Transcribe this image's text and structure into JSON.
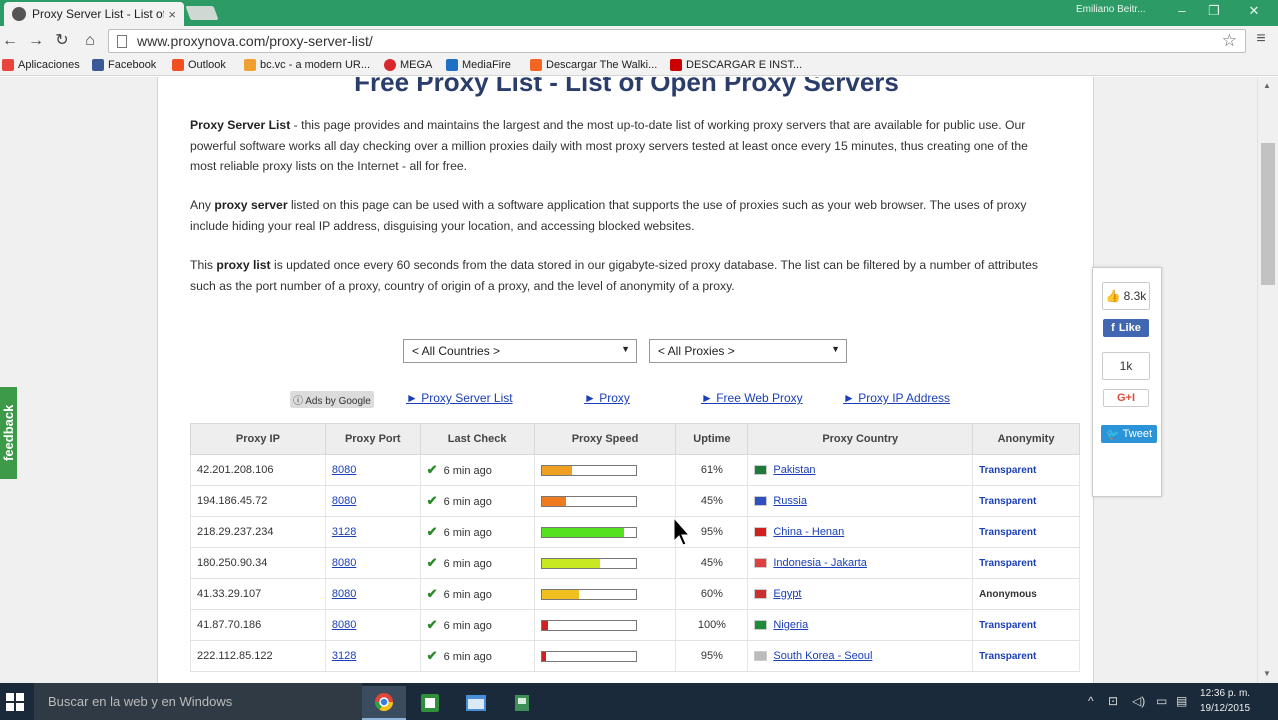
{
  "browser": {
    "tab_title": "Proxy Server List - List of F",
    "tab_close": "×",
    "user_name": "Emiliano Beitr...",
    "url": "www.proxynova.com/proxy-server-list/"
  },
  "bookmarks": [
    {
      "label": "Aplicaciones",
      "color": "#e8453c"
    },
    {
      "label": "Facebook",
      "color": "#3b5998"
    },
    {
      "label": "Outlook",
      "color": "#f25022"
    },
    {
      "label": "bc.vc - a modern UR...",
      "color": "#f0a030"
    },
    {
      "label": "MEGA",
      "color": "#d9272e"
    },
    {
      "label": "MediaFire",
      "color": "#1f6fc5"
    },
    {
      "label": "Descargar The Walki...",
      "color": "#f26522"
    },
    {
      "label": "DESCARGAR E INST...",
      "color": "#cc0000"
    }
  ],
  "page": {
    "heading": "Free Proxy List - List of Open Proxy Servers",
    "para1_bold": "Proxy Server List",
    "para1_text": " - this page provides and maintains the largest and the most up-to-date list of working proxy servers that are available for public use. Our powerful software works all day checking over a million proxies daily with most proxy servers tested at least once every 15 minutes, thus creating one of the most reliable proxy lists on the Internet - all for free.",
    "para2_pre": "Any ",
    "para2_bold": "proxy server",
    "para2_text": " listed on this page can be used with a software application that supports the use of proxies such as your web browser. The uses of proxy include hiding your real IP address, disguising your location, and accessing blocked websites.",
    "para3_pre": "This ",
    "para3_bold": "proxy list",
    "para3_text": " is updated once every 60 seconds from the data stored in our gigabyte-sized proxy database. The list can be filtered by a number of attributes such as the port number of a proxy, country of origin of a proxy, and the level of anonymity of a proxy.",
    "country_filter": "< All Countries >",
    "proxy_filter": "< All Proxies >",
    "ads_label": "ⓘ Ads by Google",
    "ad_links": [
      "► Proxy Server List",
      "► Proxy",
      "► Free Web Proxy",
      "► Proxy IP Address"
    ],
    "feedback": "feedback"
  },
  "table": {
    "headers": [
      "Proxy IP",
      "Proxy Port",
      "Last Check",
      "Proxy Speed",
      "Uptime",
      "Proxy Country",
      "Anonymity"
    ],
    "rows": [
      {
        "ip": "42.201.208.106",
        "port": "8080",
        "check": "6 min ago",
        "speed": 0.32,
        "speed_color": "#f0a020",
        "uptime": "61%",
        "country": "Pakistan",
        "flag": "#1f7a3a",
        "anon": "Transparent"
      },
      {
        "ip": "194.186.45.72",
        "port": "8080",
        "check": "6 min ago",
        "speed": 0.26,
        "speed_color": "#f07a20",
        "uptime": "45%",
        "country": "Russia",
        "flag": "#3050c0",
        "anon": "Transparent"
      },
      {
        "ip": "218.29.237.234",
        "port": "3128",
        "check": "6 min ago",
        "speed": 0.88,
        "speed_color": "#55e020",
        "uptime": "95%",
        "country": "China - Henan",
        "flag": "#d02020",
        "anon": "Transparent"
      },
      {
        "ip": "180.250.90.34",
        "port": "8080",
        "check": "6 min ago",
        "speed": 0.62,
        "speed_color": "#c8e820",
        "uptime": "45%",
        "country": "Indonesia - Jakarta",
        "flag": "#e04040",
        "anon": "Transparent"
      },
      {
        "ip": "41.33.29.107",
        "port": "8080",
        "check": "6 min ago",
        "speed": 0.4,
        "speed_color": "#f0c020",
        "uptime": "60%",
        "country": "Egypt",
        "flag": "#c83030",
        "anon": "Anonymous"
      },
      {
        "ip": "41.87.70.186",
        "port": "8080",
        "check": "6 min ago",
        "speed": 0.07,
        "speed_color": "#d02020",
        "uptime": "100%",
        "country": "Nigeria",
        "flag": "#1f8a3a",
        "anon": "Transparent"
      },
      {
        "ip": "222.112.85.122",
        "port": "3128",
        "check": "6 min ago",
        "speed": 0.05,
        "speed_color": "#d02020",
        "uptime": "95%",
        "country": "South Korea - Seoul",
        "flag": "#bbbbbb",
        "anon": "Transparent"
      }
    ]
  },
  "social": {
    "fb_count": "8.3k",
    "fb_like": "Like",
    "gplus_count": "1k",
    "gplus": "G+I",
    "tweet": "Tweet"
  },
  "taskbar": {
    "search_placeholder": "Buscar en la web y en Windows",
    "time": "12:36 p. m.",
    "date": "19/12/2015"
  }
}
